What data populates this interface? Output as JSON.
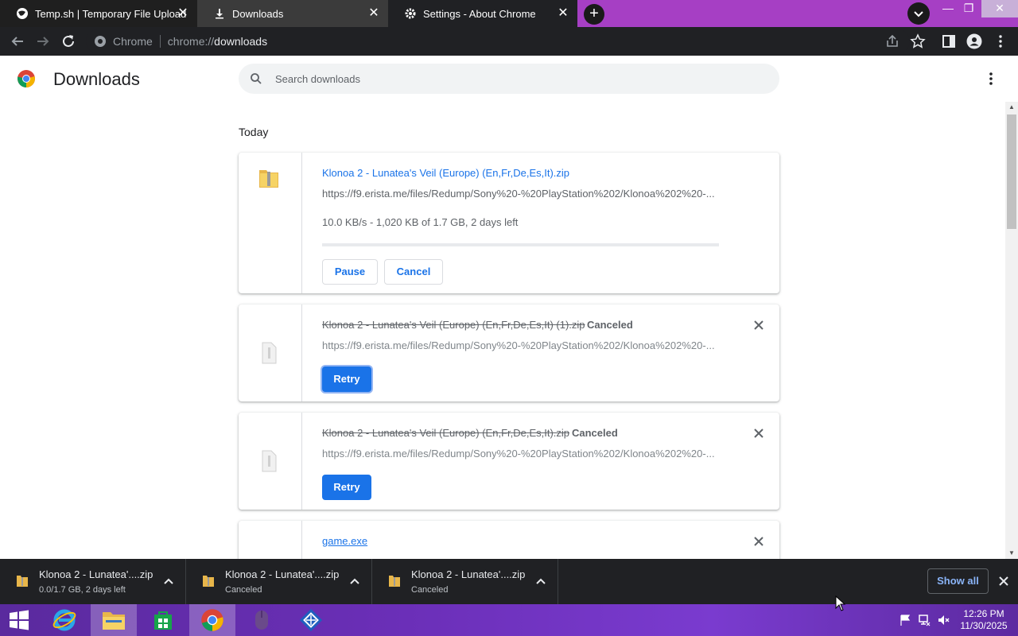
{
  "tabs": [
    {
      "title": "Temp.sh | Temporary File Upload",
      "icon": "globe-icon"
    },
    {
      "title": "Downloads",
      "icon": "download-icon"
    },
    {
      "title": "Settings - About Chrome",
      "icon": "gear-icon"
    }
  ],
  "omnibox": {
    "chip": "Chrome",
    "scheme": "chrome://",
    "host": "downloads"
  },
  "page": {
    "title": "Downloads",
    "search_placeholder": "Search downloads",
    "section": "Today"
  },
  "downloads": [
    {
      "name": "Klonoa 2 - Lunatea's Veil (Europe) (En,Fr,De,Es,It).zip",
      "url": "https://f9.erista.me/files/Redump/Sony%20-%20PlayStation%202/Klonoa%202%20-...",
      "desc": "10.0 KB/s - 1,020 KB of 1.7 GB, 2 days left",
      "progress": 0.0,
      "buttons": [
        "Pause",
        "Cancel"
      ]
    },
    {
      "name": "Klonoa 2 - Lunatea's Veil (Europe) (En,Fr,De,Es,It) (1).zip",
      "status": "Canceled",
      "url": "https://f9.erista.me/files/Redump/Sony%20-%20PlayStation%202/Klonoa%202%20-...",
      "buttons": [
        "Retry"
      ]
    },
    {
      "name": "Klonoa 2 - Lunatea's Veil (Europe) (En,Fr,De,Es,It).zip",
      "status": "Canceled",
      "url": "https://f9.erista.me/files/Redump/Sony%20-%20PlayStation%202/Klonoa%202%20-...",
      "buttons": [
        "Retry"
      ]
    },
    {
      "name": "game.exe"
    }
  ],
  "shelf": {
    "items": [
      {
        "name": "Klonoa 2 - Lunatea'....zip",
        "sub": "0.0/1.7 GB, 2 days left"
      },
      {
        "name": "Klonoa 2 - Lunatea'....zip",
        "sub": "Canceled"
      },
      {
        "name": "Klonoa 2 - Lunatea'....zip",
        "sub": "Canceled"
      }
    ],
    "show_all": "Show all"
  },
  "clock": {
    "time": "12:26 PM",
    "date": "11/30/2025"
  },
  "colors": {
    "accent": "#1a73e8",
    "tabstrip": "#a63fc4",
    "toolbar": "#202124"
  }
}
